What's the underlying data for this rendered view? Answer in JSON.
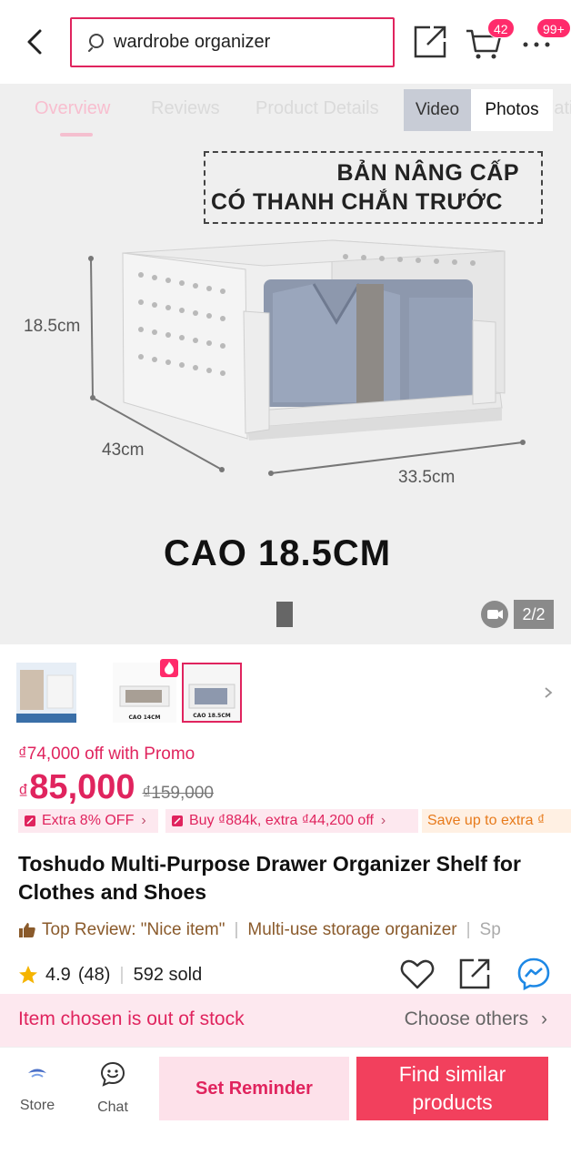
{
  "header": {
    "search_value": "wardrobe organizer",
    "cart_count": "42",
    "more_count": "99+"
  },
  "gallery": {
    "tabs": [
      "Overview",
      "Reviews",
      "Product Details",
      "Recommendation"
    ],
    "active_tab": 0,
    "media_video": "Video",
    "media_photos": "Photos",
    "promo_line1": "BẢN NÂNG CẤP",
    "promo_line2": "CÓ THANH CHẮN TRƯỚC",
    "dim_height": "18.5cm",
    "dim_depth": "43cm",
    "dim_width": "33.5cm",
    "headline": "CAO 18.5CM",
    "counter": "2/2"
  },
  "thumbnails": {
    "thumb2_caption": "CAO 14CM",
    "thumb3_caption": "CAO 18.5CM",
    "selected_index": 2
  },
  "pricing": {
    "promo_off": "₫74,000 off with Promo",
    "currency": "₫",
    "price": "85,000",
    "old_price": "₫159,000"
  },
  "vouchers": [
    "Extra 8% OFF",
    "Buy ₫884k, extra ₫44,200 off",
    "Save up to extra ₫"
  ],
  "product": {
    "title": "Toshudo Multi-Purpose Drawer Organizer Shelf for Clothes and Shoes"
  },
  "reviews": {
    "top_review": "Top Review: \"Nice item\"",
    "tag1": "Multi-use storage organizer",
    "tag2": "Sp",
    "rating": "4.9",
    "rating_count": "(48)",
    "sold": "592 sold"
  },
  "stock": {
    "message": "Item chosen is out of stock",
    "choose_others": "Choose others"
  },
  "bottom_bar": {
    "store_label": "Store",
    "chat_label": "Chat",
    "set_reminder": "Set Reminder",
    "find_similar": "Find similar products"
  },
  "colors": {
    "accent": "#e0245e",
    "button_red": "#f2405d",
    "pink_bg": "#fde8ef"
  }
}
